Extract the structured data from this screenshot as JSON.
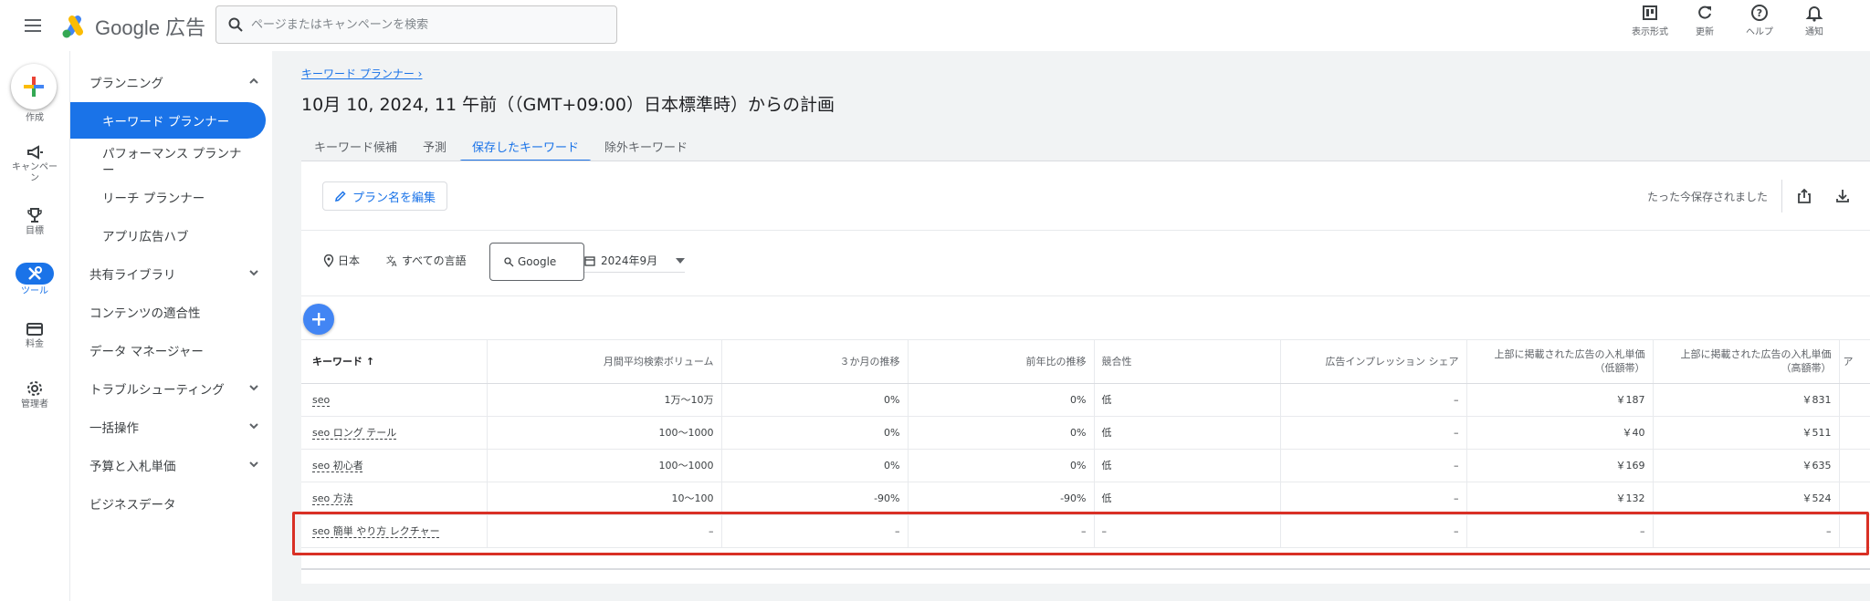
{
  "app": {
    "logo_text": "Google 広告"
  },
  "search": {
    "placeholder": "ページまたはキャンペーンを検索"
  },
  "top_actions": [
    {
      "label": "表示形式",
      "icon": "view-format-icon"
    },
    {
      "label": "更新",
      "icon": "refresh-icon"
    },
    {
      "label": "ヘルプ",
      "icon": "help-icon"
    },
    {
      "label": "通知",
      "icon": "bell-icon"
    }
  ],
  "rail": {
    "create": "作成",
    "campaign": "キャンペーン",
    "goals": "目標",
    "tools": "ツール",
    "billing": "料金",
    "admin": "管理者"
  },
  "nav": {
    "planning": "プランニング",
    "keyword_planner": "キーワード プランナー",
    "performance_planner": "パフォーマンス プランナ\nー",
    "reach_planner": "リーチ プランナー",
    "app_ads_hub": "アプリ広告ハブ",
    "shared_library": "共有ライブラリ",
    "content_suitability": "コンテンツの適合性",
    "data_manager": "データ マネージャー",
    "troubleshooting": "トラブルシューティング",
    "bulk_actions": "一括操作",
    "budgets_bidding": "予算と入札単価",
    "business_data": "ビジネスデータ"
  },
  "main": {
    "breadcrumb": "キーワード プランナー",
    "title": "10月 10, 2024, 11 午前（（GMT+09:00）日本標準時）からの計画",
    "tabs": [
      "キーワード候補",
      "予測",
      "保存したキーワード",
      "除外キーワード"
    ],
    "active_tab": 2,
    "edit_plan_label": "プラン名を編集",
    "saved_status": "たった今保存されました",
    "filters": {
      "location": "日本",
      "language": "すべての言語",
      "network": "Google",
      "date": "2024年9月"
    }
  },
  "table": {
    "headers": [
      "キーワード",
      "月間平均検索ボリューム",
      "３か月の推移",
      "前年比の推移",
      "競合性",
      "広告インプレッション シェア",
      "上部に掲載された広告の入札単価\n（低額帯）",
      "上部に掲載された広告の入札単価\n（高額帯）",
      "ア"
    ],
    "rows": [
      [
        "seo",
        "1万～10万",
        "0%",
        "0%",
        "低",
        "–",
        "￥187",
        "￥831"
      ],
      [
        "seo ロング テール",
        "100～1000",
        "0%",
        "0%",
        "低",
        "–",
        "￥40",
        "￥511"
      ],
      [
        "seo 初心者",
        "100～1000",
        "0%",
        "0%",
        "低",
        "–",
        "￥169",
        "￥635"
      ],
      [
        "seo 方法",
        "10～100",
        "-90%",
        "-90%",
        "低",
        "–",
        "￥132",
        "￥524"
      ],
      [
        "seo 簡単 やり方 レクチャー",
        "–",
        "–",
        "–",
        "–",
        "–",
        "–",
        "–"
      ]
    ]
  },
  "colors": {
    "accent": "#1a73e8",
    "highlight": "#d93025",
    "background": "#f1f3f4"
  }
}
